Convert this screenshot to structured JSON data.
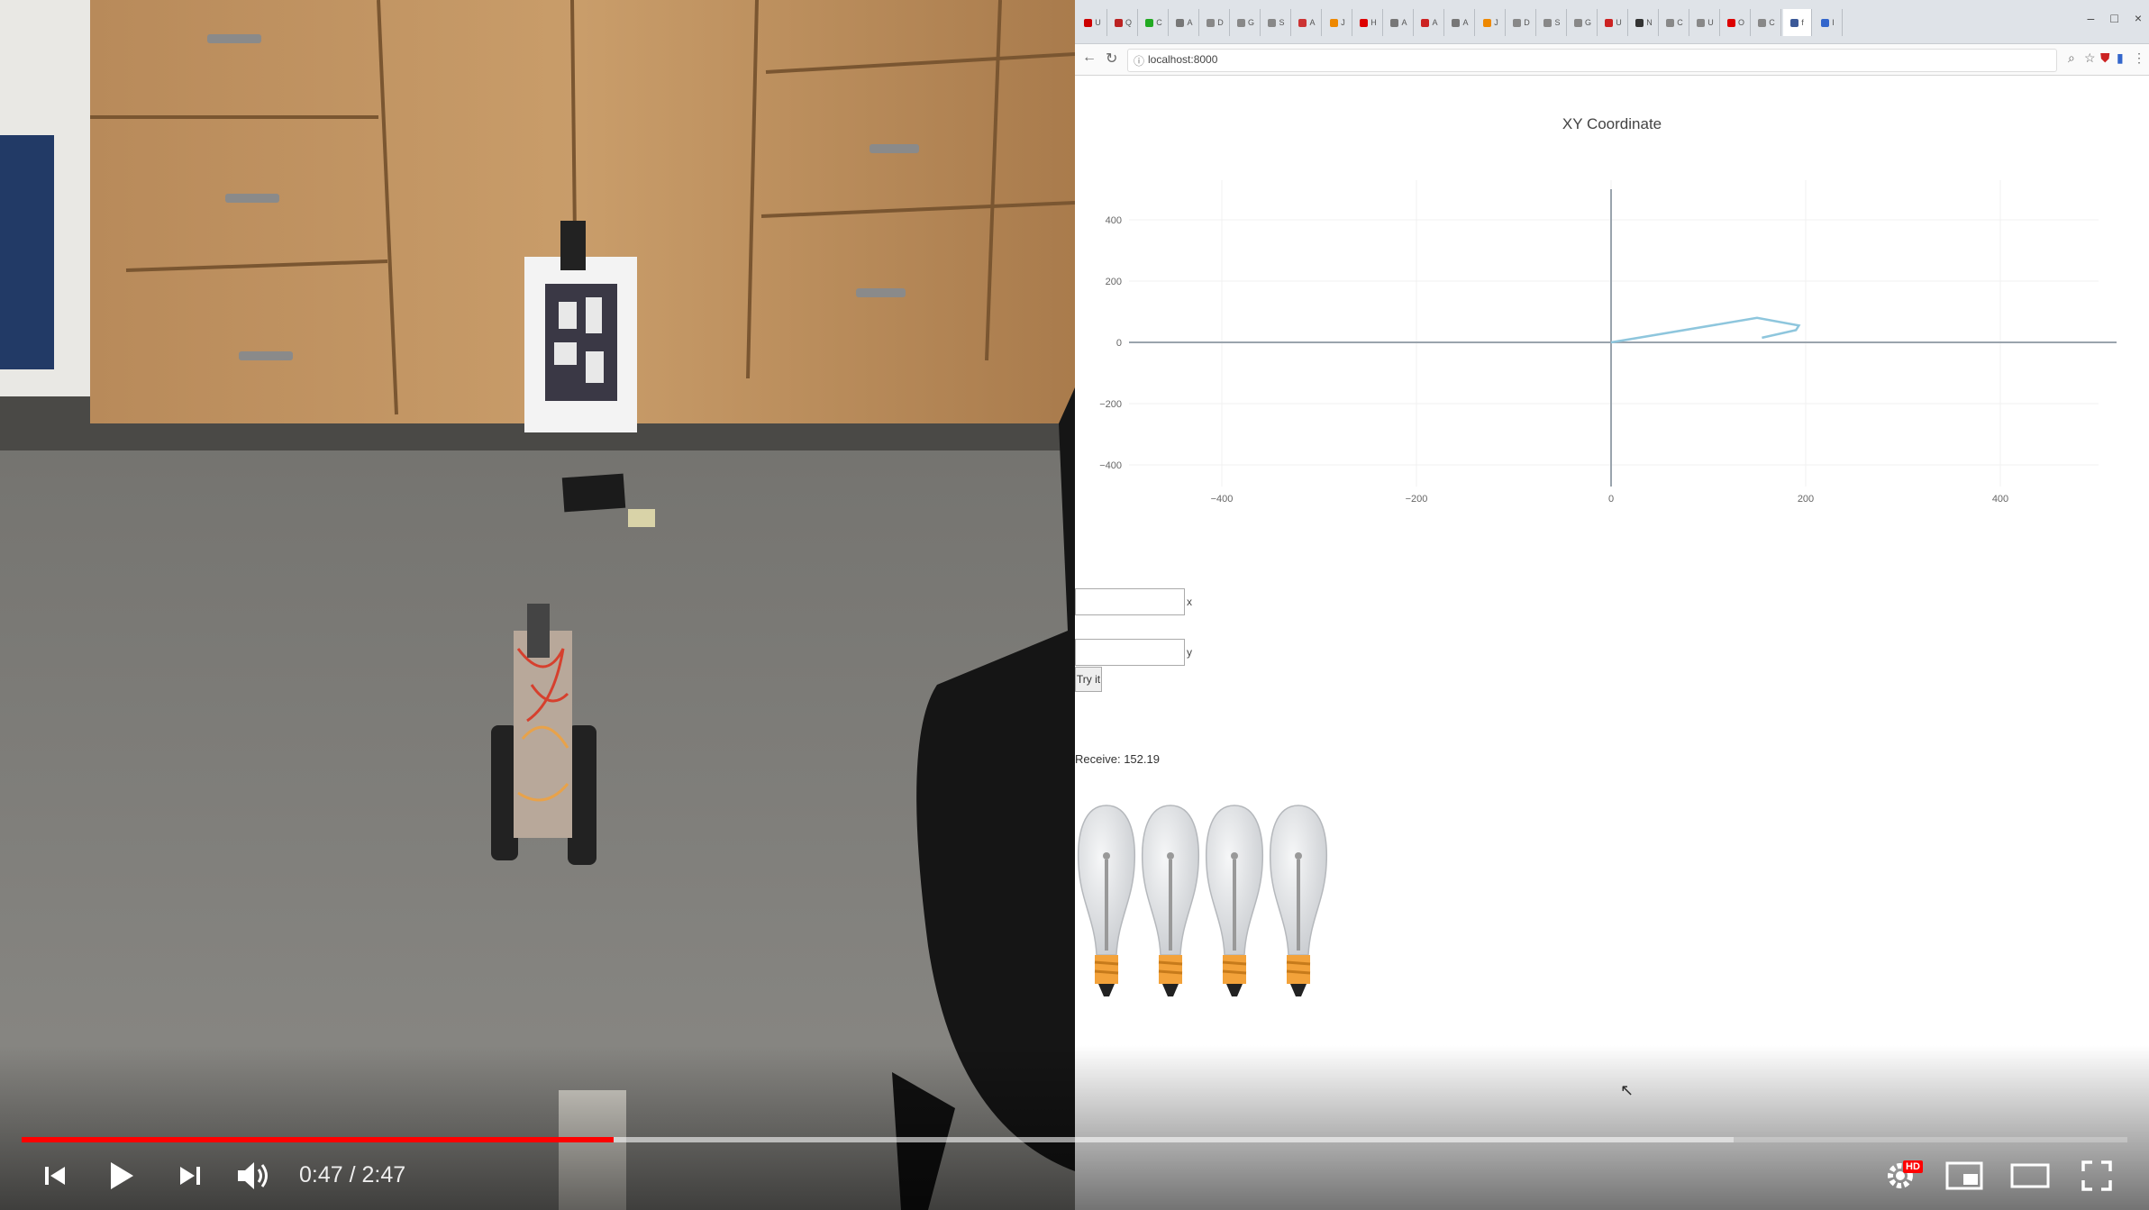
{
  "player": {
    "current_time": "0:47",
    "duration": "2:47",
    "time_separator": " / ",
    "progress_played_fraction": 0.281,
    "progress_buffered_fraction": 0.813,
    "hd_badge": "HD",
    "colors": {
      "progress_played": "#ff0000",
      "progress_track": "#ffffff",
      "hd_badge": "#ff0000"
    },
    "icons": [
      "previous-icon",
      "play-icon",
      "next-icon",
      "volume-icon",
      "settings-icon",
      "miniplayer-icon",
      "theater-mode-icon",
      "fullscreen-icon"
    ]
  },
  "browser": {
    "tabs": [
      {
        "label": "U",
        "color": "#c00"
      },
      {
        "label": "Q",
        "color": "#b22"
      },
      {
        "label": "C",
        "color": "#2a2"
      },
      {
        "label": "A",
        "color": "#777"
      },
      {
        "label": "D",
        "color": "#888"
      },
      {
        "label": "G",
        "color": "#888"
      },
      {
        "label": "S",
        "color": "#888"
      },
      {
        "label": "A",
        "color": "#c33"
      },
      {
        "label": "J",
        "color": "#e80"
      },
      {
        "label": "H",
        "color": "#d00"
      },
      {
        "label": "A",
        "color": "#777"
      },
      {
        "label": "A",
        "color": "#c22"
      },
      {
        "label": "A",
        "color": "#777"
      },
      {
        "label": "J",
        "color": "#e80"
      },
      {
        "label": "D",
        "color": "#888"
      },
      {
        "label": "S",
        "color": "#888"
      },
      {
        "label": "G",
        "color": "#888"
      },
      {
        "label": "U",
        "color": "#c22"
      },
      {
        "label": "N",
        "color": "#333"
      },
      {
        "label": "C",
        "color": "#888"
      },
      {
        "label": "U",
        "color": "#888"
      },
      {
        "label": "O",
        "color": "#d00"
      },
      {
        "label": "C",
        "color": "#888"
      },
      {
        "label": "f",
        "color": "#3b5998"
      },
      {
        "label": "I",
        "color": "#36c"
      }
    ],
    "url": "localhost:8000",
    "window_controls": [
      "–",
      "□",
      "×"
    ]
  },
  "page": {
    "input_x_suffix": "x",
    "input_y_suffix": "y",
    "try_button_label": "Try it",
    "receive_label": "Receive: 152.19",
    "bulb_count": 4
  },
  "chart_data": {
    "type": "line",
    "title": "XY Coordinate",
    "xlabel": "",
    "ylabel": "",
    "xlim": [
      -500,
      500
    ],
    "ylim": [
      -500,
      500
    ],
    "x_ticks": [
      -400,
      -200,
      0,
      200,
      400
    ],
    "y_ticks": [
      400,
      200,
      0,
      -200,
      -400
    ],
    "x_tick_labels": [
      "−400",
      "−200",
      "0",
      "200",
      "400"
    ],
    "y_tick_labels": [
      "400",
      "200",
      "0",
      "−200",
      "−400"
    ],
    "grid": true,
    "series": [
      {
        "color": "#8ec6dd",
        "x": [
          0,
          150,
          193,
          190,
          155
        ],
        "y": [
          0,
          80,
          55,
          40,
          15
        ]
      }
    ]
  }
}
